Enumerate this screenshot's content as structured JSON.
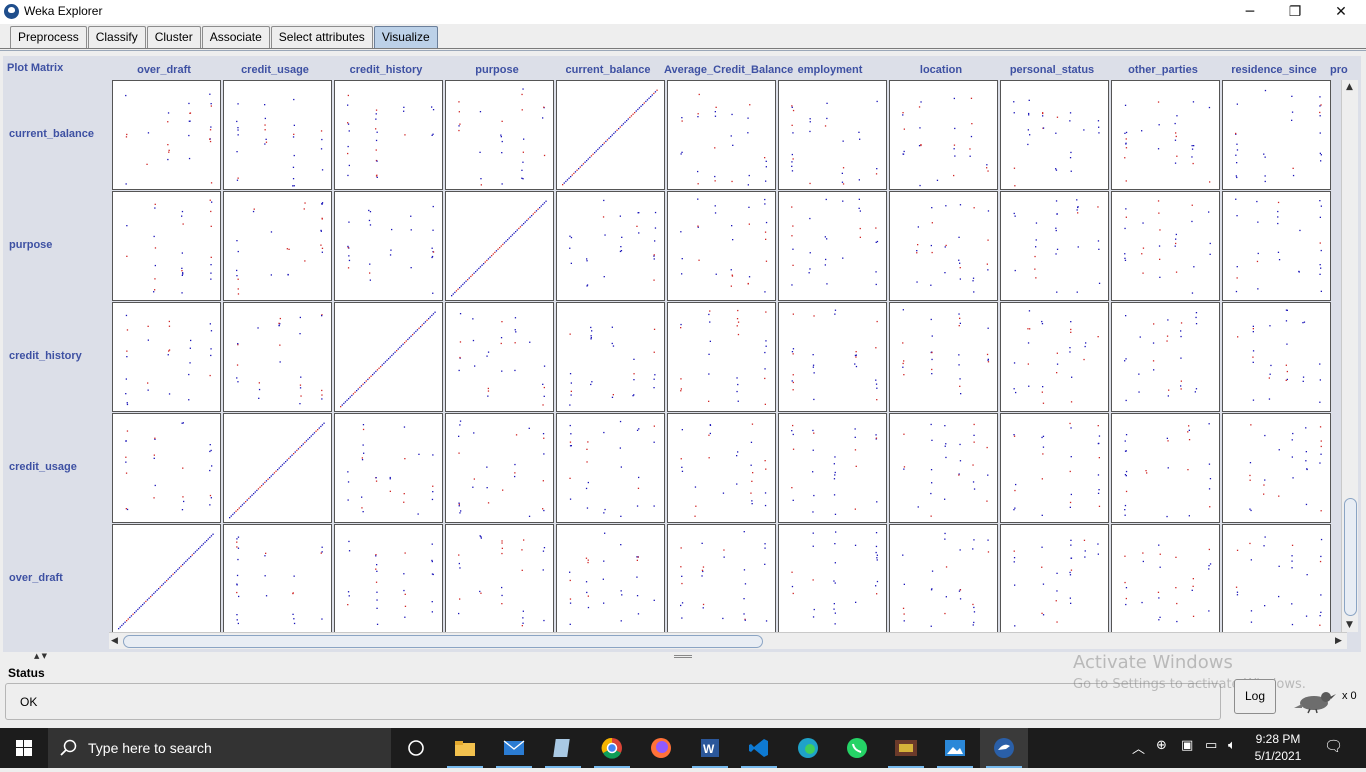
{
  "window": {
    "title": "Weka Explorer",
    "minimize_label": "─",
    "maximize_label": "❐",
    "close_label": "✕"
  },
  "tabs": [
    {
      "label": "Preprocess",
      "active": false
    },
    {
      "label": "Classify",
      "active": false
    },
    {
      "label": "Cluster",
      "active": false
    },
    {
      "label": "Associate",
      "active": false
    },
    {
      "label": "Select attributes",
      "active": false
    },
    {
      "label": "Visualize",
      "active": true
    }
  ],
  "plot_matrix": {
    "label": "Plot Matrix",
    "columns": [
      "over_draft",
      "credit_usage",
      "credit_history",
      "purpose",
      "current_balance",
      "Average_Credit_Balance",
      "employment",
      "location",
      "personal_status",
      "other_parties",
      "residence_since",
      "pro"
    ],
    "rows": [
      "current_balance",
      "purpose",
      "credit_history",
      "credit_usage",
      "over_draft"
    ],
    "point_colors": [
      "#1a14b8",
      "#d02626"
    ]
  },
  "status": {
    "title": "Status",
    "text": "OK",
    "log_button": "Log",
    "task_count": "x 0"
  },
  "watermark": {
    "line1": "Activate Windows",
    "line2": "Go to Settings to activate Windows."
  },
  "taskbar": {
    "search_placeholder": "Type here to search",
    "apps": [
      "task-view",
      "file-explorer",
      "mail",
      "notepad",
      "chrome",
      "firefox",
      "word",
      "vscode",
      "edge",
      "whatsapp",
      "game",
      "photos",
      "weka"
    ],
    "time": "9:28 PM",
    "date": "5/1/2021"
  }
}
